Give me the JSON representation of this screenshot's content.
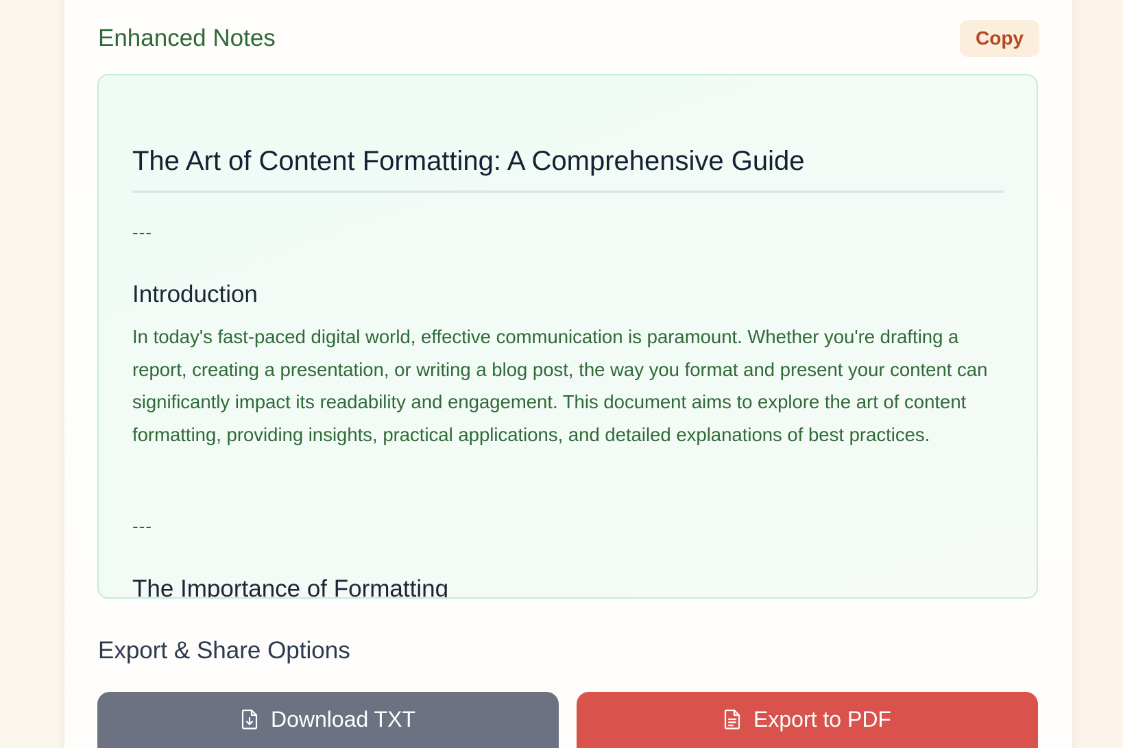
{
  "notes": {
    "heading": "Enhanced Notes",
    "copy_label": "Copy"
  },
  "document": {
    "title": "The Art of Content Formatting: A Comprehensive Guide",
    "separator": "---",
    "sections": [
      {
        "heading": "Introduction",
        "paragraph": "In today's fast-paced digital world, effective communication is paramount. Whether you're drafting a report, creating a presentation, or writing a blog post, the way you format and present your content can significantly impact its readability and engagement. This document aims to explore the art of content formatting, providing insights, practical applications, and detailed explanations of best practices."
      },
      {
        "heading": "The Importance of Formatting"
      }
    ]
  },
  "export": {
    "heading": "Export & Share Options",
    "download_label": "Download TXT",
    "download_icon": "file-download-icon",
    "pdf_label": "Export to PDF",
    "pdf_icon": "file-text-icon"
  },
  "colors": {
    "accent_green": "#2f6a36",
    "copy_text": "#b5481f",
    "download_button": "#6c7282",
    "pdf_button": "#d9524b"
  }
}
